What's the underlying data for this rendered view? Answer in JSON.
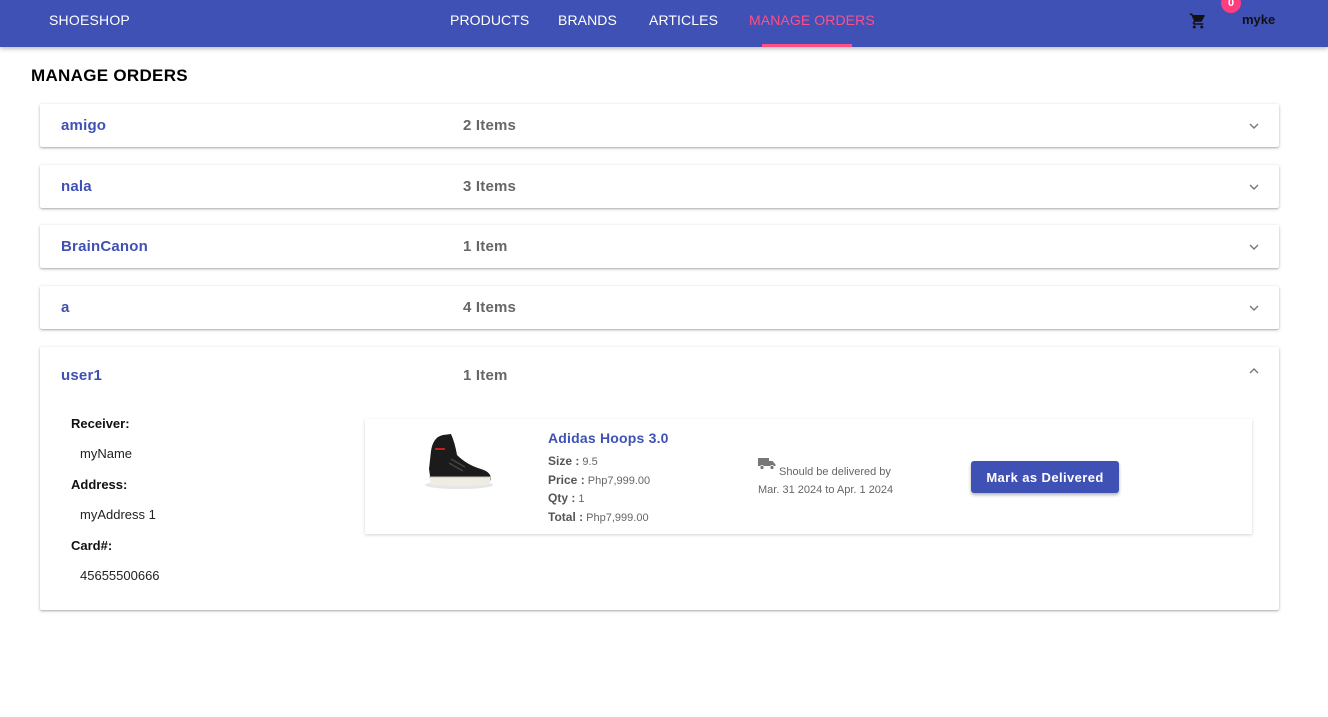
{
  "header": {
    "brand": "SHOESHOP",
    "nav": [
      "PRODUCTS",
      "BRANDS",
      "ARTICLES",
      "MANAGE ORDERS"
    ],
    "active_nav": "MANAGE ORDERS",
    "cart_count": "0",
    "username": "myke",
    "accent_color": "#3f51b5",
    "active_color": "#ff4f87"
  },
  "page": {
    "title": "MANAGE ORDERS"
  },
  "orders": [
    {
      "name": "amigo",
      "count": "2 Items"
    },
    {
      "name": "nala",
      "count": "3 Items"
    },
    {
      "name": "BrainCanon",
      "count": "1 Item"
    },
    {
      "name": "a",
      "count": "4 Items"
    },
    {
      "name": "user1",
      "count": "1 Item",
      "expanded": true,
      "receiver_label": "Receiver:",
      "receiver": "myName",
      "address_label": "Address:",
      "address": "myAddress 1",
      "card_label": "Card#:",
      "card": "45655500666",
      "item": {
        "name": "Adidas Hoops 3.0",
        "size_label": "Size :",
        "size": "9.5",
        "price_label": "Price :",
        "price": "Php7,999.00",
        "qty_label": "Qty :",
        "qty": "1",
        "total_label": "Total :",
        "total": "Php7,999.00",
        "delivery_text": "Should be delivered by",
        "delivery_range": "Mar. 31 2024 to Apr. 1 2024",
        "action_label": "Mark as Delivered"
      }
    }
  ],
  "icons": {
    "cart": "shopping-cart-icon",
    "expand": "chevron-down-icon",
    "collapse": "chevron-up-icon",
    "delivery": "truck-icon"
  }
}
